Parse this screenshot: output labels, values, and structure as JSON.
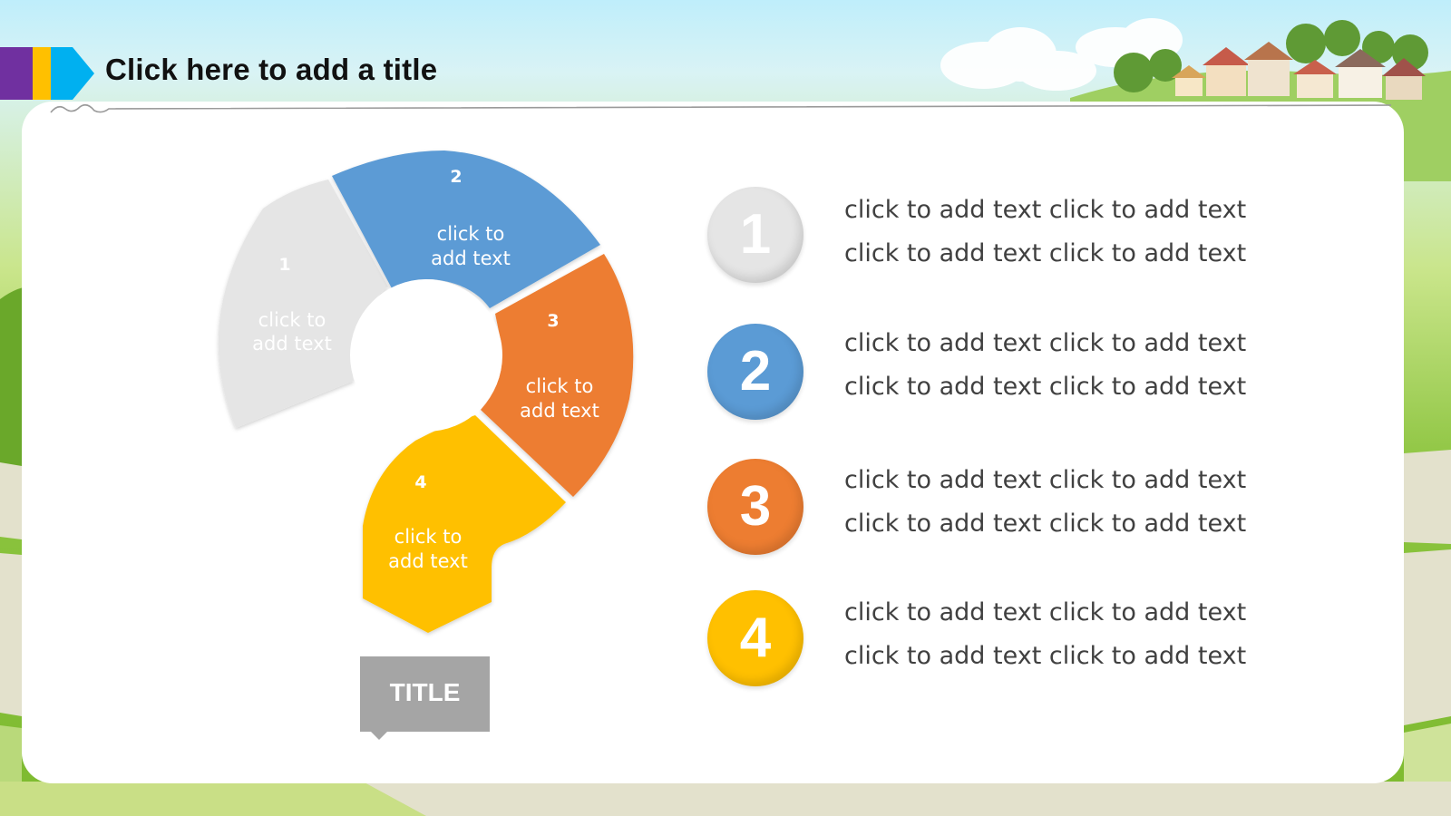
{
  "slide": {
    "title": "Click here to add a title",
    "tag_label": "TITLE"
  },
  "segments": [
    {
      "number": "1",
      "line1": "click to",
      "line2": "add text",
      "color": "#e5e5e5"
    },
    {
      "number": "2",
      "line1": "click to",
      "line2": "add text",
      "color": "#5b9bd5"
    },
    {
      "number": "3",
      "line1": "click to",
      "line2": "add text",
      "color": "#ed7d31"
    },
    {
      "number": "4",
      "line1": "click to",
      "line2": "add text",
      "color": "#ffc000"
    }
  ],
  "list": [
    {
      "number": "1",
      "line1": "click to add text click to add text",
      "line2": "click to add text click to add text",
      "color": "#e5e5e5"
    },
    {
      "number": "2",
      "line1": "click to add text click to add text",
      "line2": "click to add text click to add text",
      "color": "#5b9bd5"
    },
    {
      "number": "3",
      "line1": "click to add text click to add text",
      "line2": "click to add text click to add text",
      "color": "#ed7d31"
    },
    {
      "number": "4",
      "line1": "click to add text click to add text",
      "line2": "click to add text click to add text",
      "color": "#ffc000"
    }
  ],
  "colors": {
    "accent_purple": "#7030a0",
    "accent_yellow": "#ffc000",
    "accent_blue": "#00b0f0",
    "tag_gray": "#a5a5a5"
  }
}
